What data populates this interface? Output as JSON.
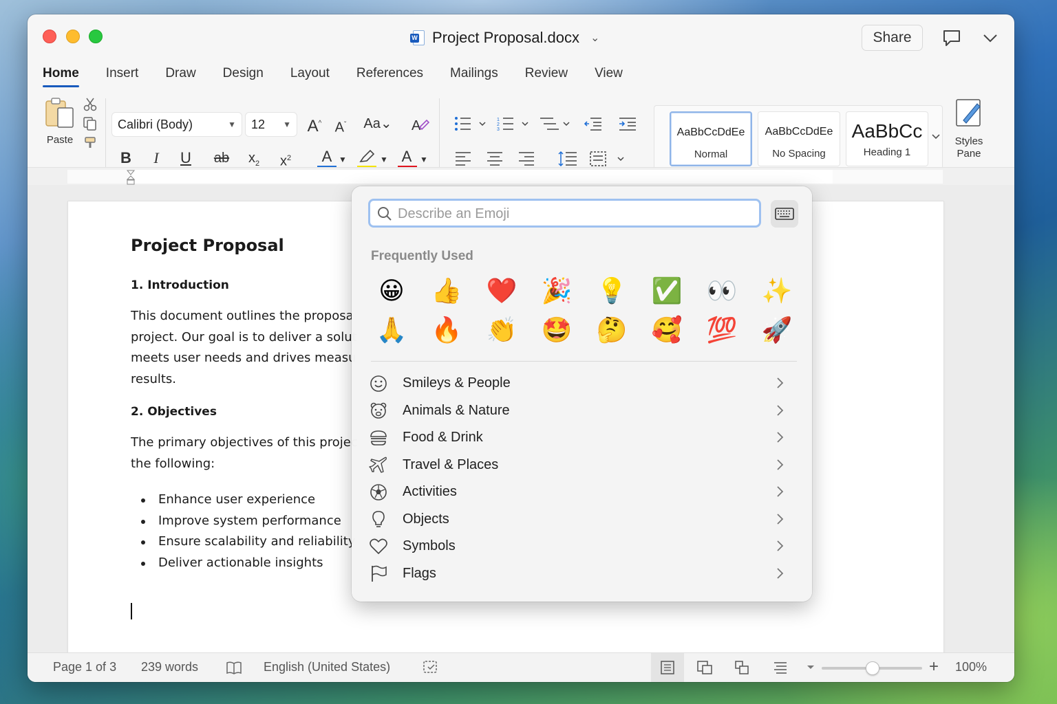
{
  "window": {
    "doc_title": "Project Proposal.docx",
    "share_label": "Share"
  },
  "tabs": [
    "Home",
    "Insert",
    "Draw",
    "Design",
    "Layout",
    "References",
    "Mailings",
    "Review",
    "View"
  ],
  "ribbon": {
    "paste_label": "Paste",
    "font_name": "Calibri (Body)",
    "font_size": "12",
    "styles": [
      {
        "sample": "AaBbCcDdEe",
        "name": "Normal"
      },
      {
        "sample": "AaBbCcDdEe",
        "name": "No Spacing"
      },
      {
        "sample": "AaBbCc",
        "name": "Heading 1"
      }
    ],
    "styles_pane_label_1": "Styles",
    "styles_pane_label_2": "Pane"
  },
  "document": {
    "title": "Project Proposal",
    "h_intro": "1. Introduction",
    "intro_lines": [
      "This document outlines the proposa",
      "project. Our goal is to deliver a solut",
      "meets user needs and drives measu",
      "results."
    ],
    "h_objectives": "2. Objectives",
    "obj_lines": [
      "The primary objectives of this projec",
      "the following:"
    ],
    "bullets": [
      "Enhance user experience",
      "Improve system performance",
      "Ensure scalability and reliability",
      "Deliver actionable insights"
    ]
  },
  "emoji_picker": {
    "search_placeholder": "Describe an Emoji",
    "section_title": "Frequently Used",
    "emojis": [
      "😀",
      "👍",
      "❤️",
      "🎉",
      "💡",
      "✅",
      "👀",
      "✨",
      "🙏",
      "🔥",
      "👏",
      "🤩",
      "🤔",
      "🥰",
      "💯",
      "🚀"
    ],
    "categories": [
      "Smileys & People",
      "Animals & Nature",
      "Food & Drink",
      "Travel & Places",
      "Activities",
      "Objects",
      "Symbols",
      "Flags"
    ]
  },
  "statusbar": {
    "page": "Page 1 of 3",
    "words": "239 words",
    "language": "English (United States)",
    "zoom": "100%",
    "zoom_level_percent": 100
  },
  "colors": {
    "accent": "#185abd",
    "font_color_underline": "#1f6fd6",
    "highlight_underline": "#f5e400",
    "text_red_underline": "#e0141e"
  }
}
